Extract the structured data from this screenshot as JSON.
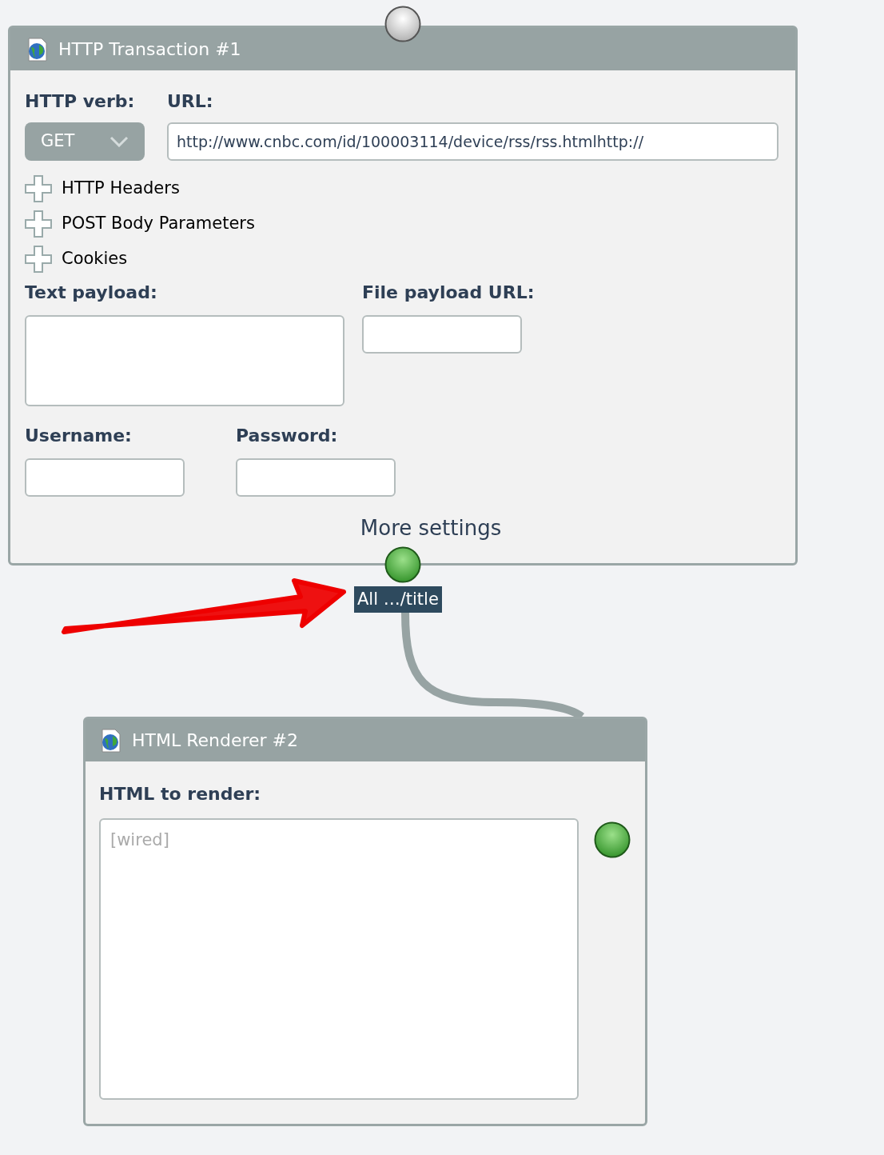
{
  "http_node": {
    "title": "HTTP Transaction #1",
    "input_terminal": {
      "connected": false
    },
    "verb_label": "HTTP verb:",
    "verb": "GET",
    "url_label": "URL:",
    "url": "http://www.cnbc.com/id/100003114/device/rss/rss.htmlhttp://",
    "expanders": [
      {
        "label": "HTTP Headers",
        "expanded": false
      },
      {
        "label": "POST Body Parameters",
        "expanded": false
      },
      {
        "label": "Cookies",
        "expanded": false
      }
    ],
    "text_payload_label": "Text payload:",
    "file_payload_label": "File payload URL:",
    "username_label": "Username:",
    "password_label": "Password:",
    "more_settings": "More settings",
    "output_terminal": {
      "connected": true
    }
  },
  "wire": {
    "label": "All …/title"
  },
  "renderer_node": {
    "title": "HTML Renderer #2",
    "html_label": "HTML to render:",
    "placeholder": "[wired]",
    "terminal": {
      "connected": true
    }
  }
}
